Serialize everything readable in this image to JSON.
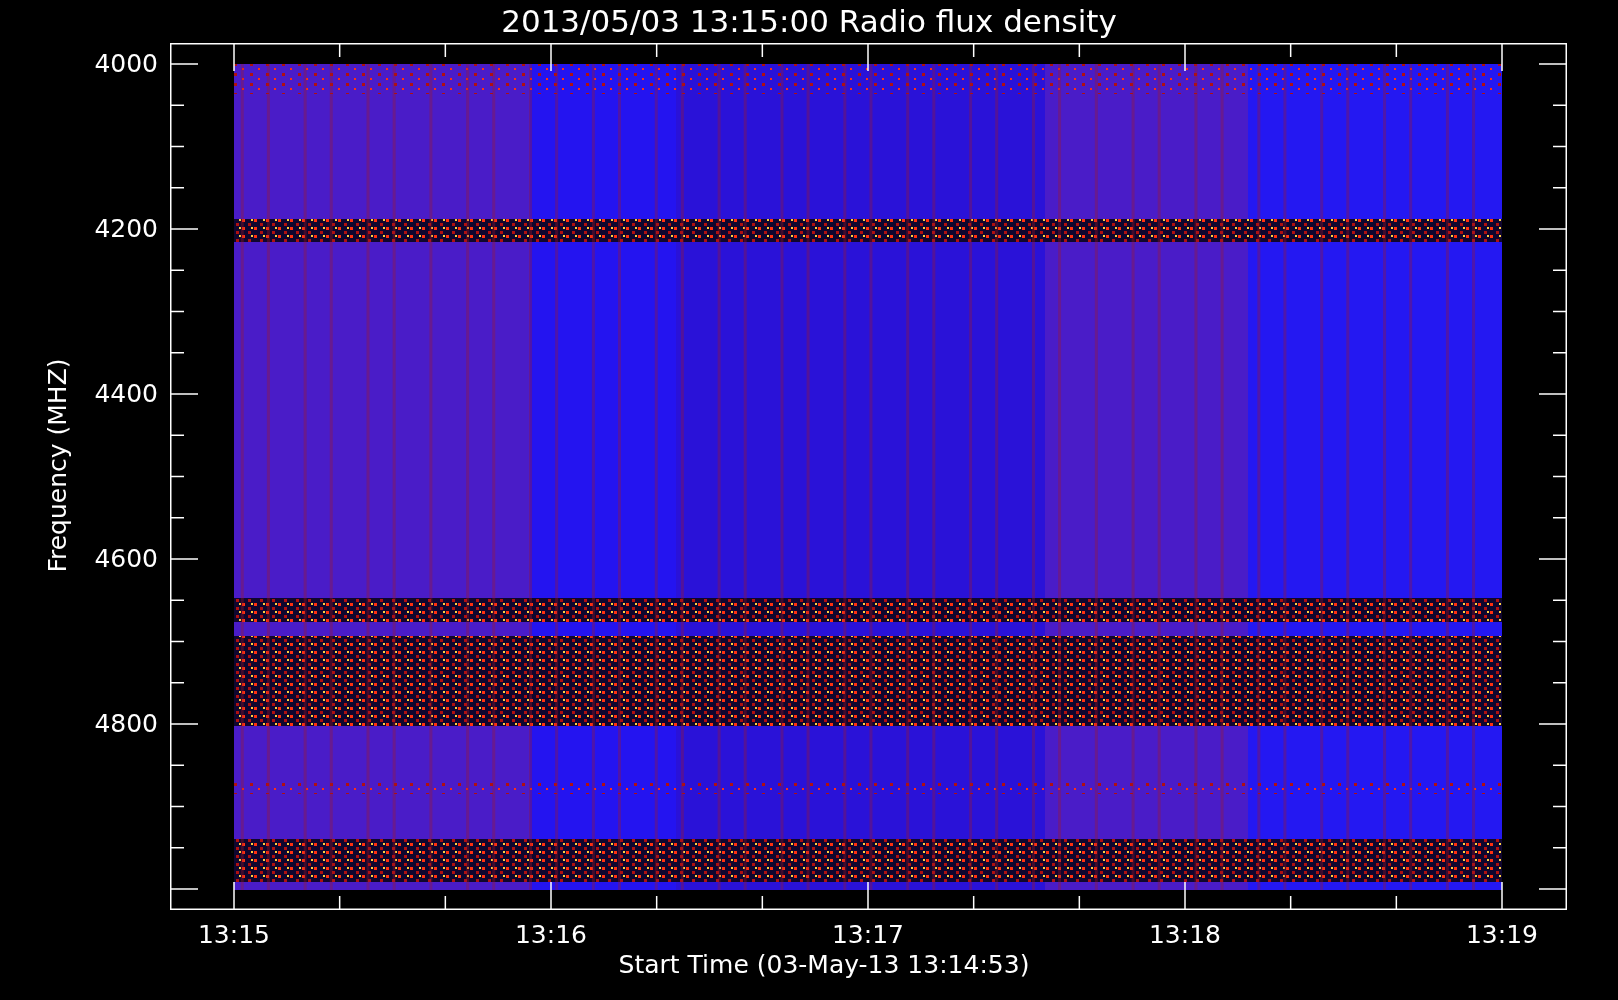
{
  "title": "2013/05/03 13:15:00 Radio flux density",
  "y_axis": {
    "label": "Frequency (MHZ)",
    "ticks": [
      "4000",
      "4200",
      "4400",
      "4600",
      "4800"
    ]
  },
  "x_axis": {
    "label": "Start Time (03-May-13 13:14:53)",
    "ticks": [
      "13:15",
      "13:16",
      "13:17",
      "13:18",
      "13:19"
    ]
  }
}
